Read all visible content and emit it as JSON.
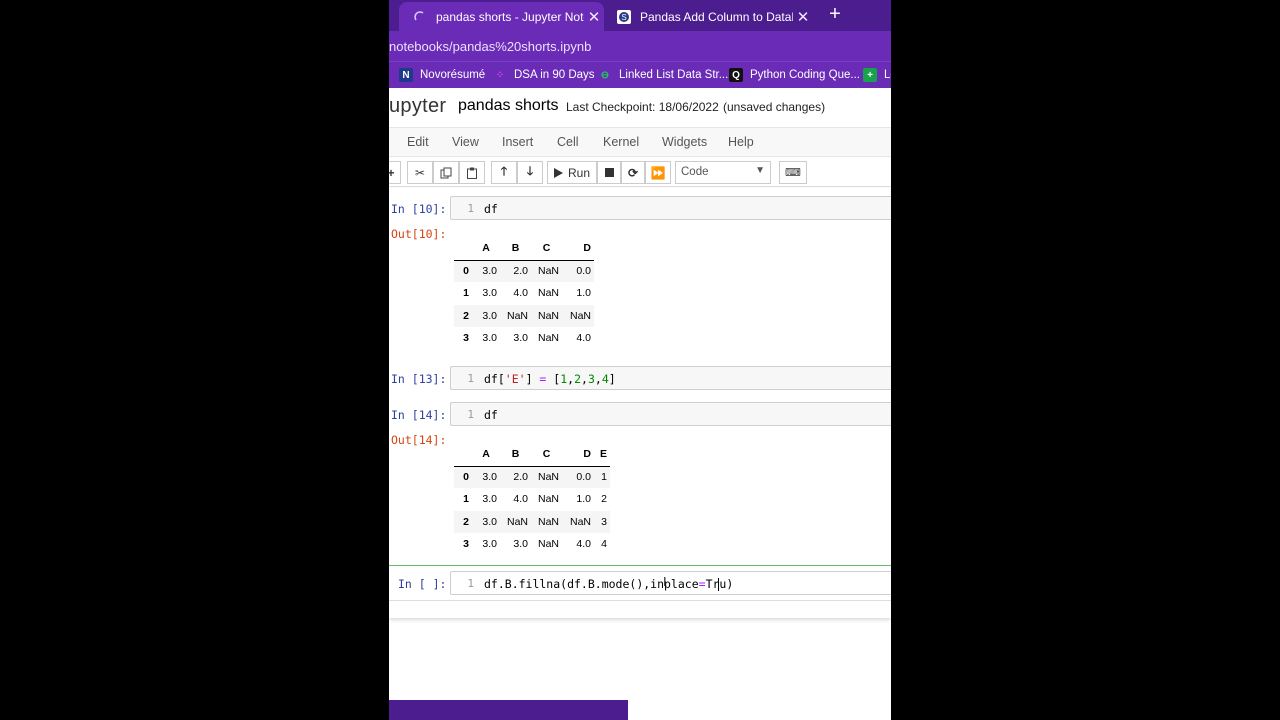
{
  "browser": {
    "tabs": [
      {
        "title": "pandas shorts - Jupyter Notebook",
        "icon": "jupyter-loading-icon",
        "active": true
      },
      {
        "title": "Pandas Add Column to DataFrame",
        "icon": "site-s-icon",
        "active": false
      }
    ],
    "new_tab_label": "+",
    "close_label": "✕",
    "url": "notebooks/pandas%20shorts.ipynb",
    "bookmarks": [
      {
        "label": "Novorésumé",
        "icon": "N",
        "color": "#1e3a8a"
      },
      {
        "label": "DSA in 90 Days",
        "icon": "::",
        "color": "#d946ef"
      },
      {
        "label": "Linked List Data Str...",
        "icon": "⊖",
        "color": "#22c55e"
      },
      {
        "label": "Python Coding Que...",
        "icon": "Q",
        "color": "#111111"
      },
      {
        "label": "Le",
        "icon": "+",
        "color": "#16a34a"
      }
    ]
  },
  "jupyter": {
    "logo_text": "upyter",
    "notebook_name": "pandas shorts",
    "checkpoint": "Last Checkpoint: 18/06/2022",
    "unsaved": "(unsaved changes)",
    "menu": [
      "Edit",
      "View",
      "Insert",
      "Cell",
      "Kernel",
      "Widgets",
      "Help"
    ],
    "toolbar": {
      "run_label": "Run",
      "cell_type": "Code"
    }
  },
  "cells": {
    "c10": {
      "prompt": "In [10]:",
      "line": "1",
      "code": "df",
      "out_prompt": "Out[10]:"
    },
    "c13": {
      "prompt": "In [13]:",
      "line": "1",
      "code_parts": [
        "df[",
        "'E'",
        "] ",
        "=",
        " [",
        "1",
        ",",
        "2",
        ",",
        "3",
        ",",
        "4",
        "]"
      ]
    },
    "c14": {
      "prompt": "In [14]:",
      "line": "1",
      "code": "df",
      "out_prompt": "Out[14]:"
    },
    "current": {
      "prompt": "In [ ]:",
      "line": "1",
      "code_parts": [
        "df.B.fillna(df.B.mode(),inplace",
        "=",
        "Tru",
        ")"
      ]
    }
  },
  "tables": {
    "t10": {
      "columns": [
        "",
        "A",
        "B",
        "C",
        "D"
      ],
      "rows": [
        [
          "0",
          "3.0",
          "2.0",
          "NaN",
          "0.0"
        ],
        [
          "1",
          "3.0",
          "4.0",
          "NaN",
          "1.0"
        ],
        [
          "2",
          "3.0",
          "NaN",
          "NaN",
          "NaN"
        ],
        [
          "3",
          "3.0",
          "3.0",
          "NaN",
          "4.0"
        ]
      ]
    },
    "t14": {
      "columns": [
        "",
        "A",
        "B",
        "C",
        "D",
        "E"
      ],
      "rows": [
        [
          "0",
          "3.0",
          "2.0",
          "NaN",
          "0.0",
          "1"
        ],
        [
          "1",
          "3.0",
          "4.0",
          "NaN",
          "1.0",
          "2"
        ],
        [
          "2",
          "3.0",
          "NaN",
          "NaN",
          "NaN",
          "3"
        ],
        [
          "3",
          "3.0",
          "3.0",
          "NaN",
          "4.0",
          "4"
        ]
      ]
    }
  },
  "colors": {
    "browser_dark": "#4b1d8f",
    "browser_light": "#6a2bb6",
    "prompt_in": "#303f9f",
    "prompt_out": "#d84315",
    "selected_border": "#66bb6a"
  }
}
